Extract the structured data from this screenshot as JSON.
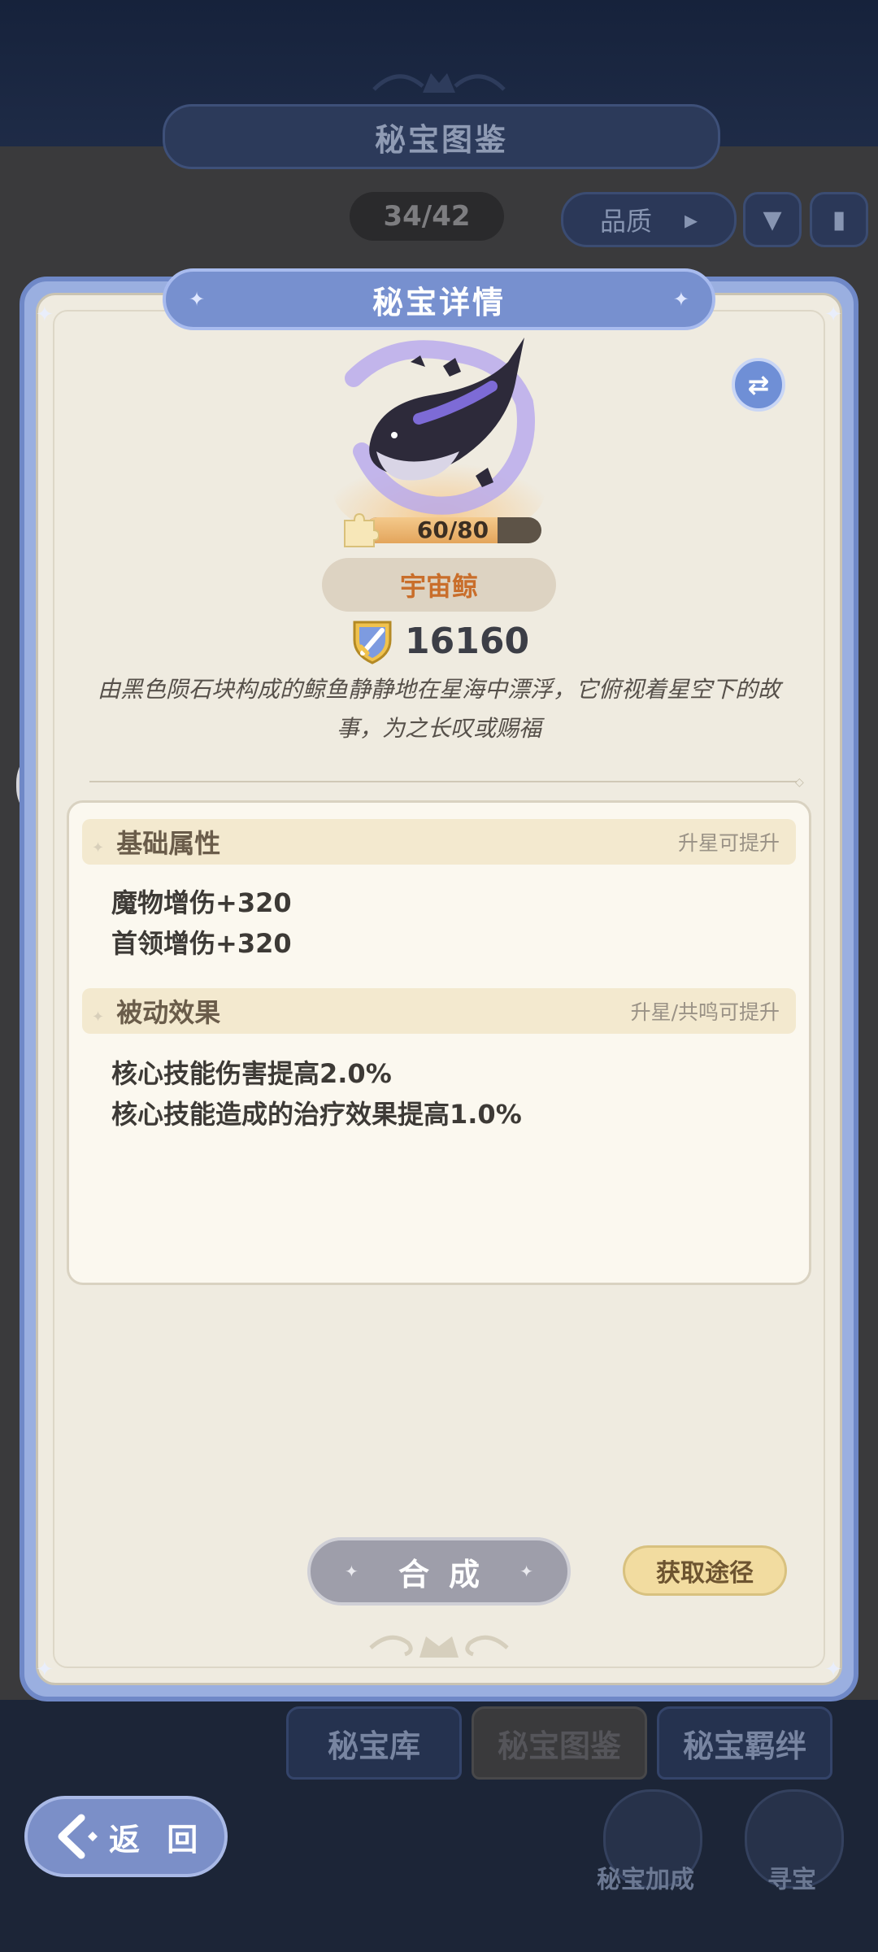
{
  "background": {
    "title": "秘宝图鉴",
    "counter": "34/42",
    "quality_filter": "品质",
    "tabs": [
      "秘宝库",
      "秘宝图鉴",
      "秘宝羁绊"
    ],
    "bottom_buttons": [
      "秘宝加成",
      "寻宝"
    ]
  },
  "back_button": {
    "label": "返 回"
  },
  "modal": {
    "title": "秘宝详情",
    "treasure": {
      "name": "宇宙鲸",
      "progress_text": "60/80",
      "progress": 0.75,
      "power": "16160",
      "description": "由黑色陨石块构成的鲸鱼静静地在星海中漂浮，它俯视着星空下的故事，为之长叹或赐福"
    },
    "sections": {
      "basic": {
        "title": "基础属性",
        "note": "升星可提升",
        "lines": [
          "魔物增伤+320",
          "首领增伤+320"
        ]
      },
      "passive": {
        "title": "被动效果",
        "note": "升星/共鸣可提升",
        "lines": [
          "核心技能伤害提高2.0%",
          "核心技能造成的治疗效果提高1.0%"
        ]
      }
    },
    "buttons": {
      "synthesize": "合成",
      "obtain": "获取途径"
    }
  },
  "icons": {
    "swap": "swap-arrows-icon",
    "chat": "chat-bubble-icon",
    "power": "sword-shield-icon",
    "progress": "puzzle-piece-icon",
    "back": "back-arrow-icon"
  },
  "colors": {
    "frame": "#7790cf",
    "name_text": "#c96e2b",
    "obtain_button": "#f2dca0"
  }
}
